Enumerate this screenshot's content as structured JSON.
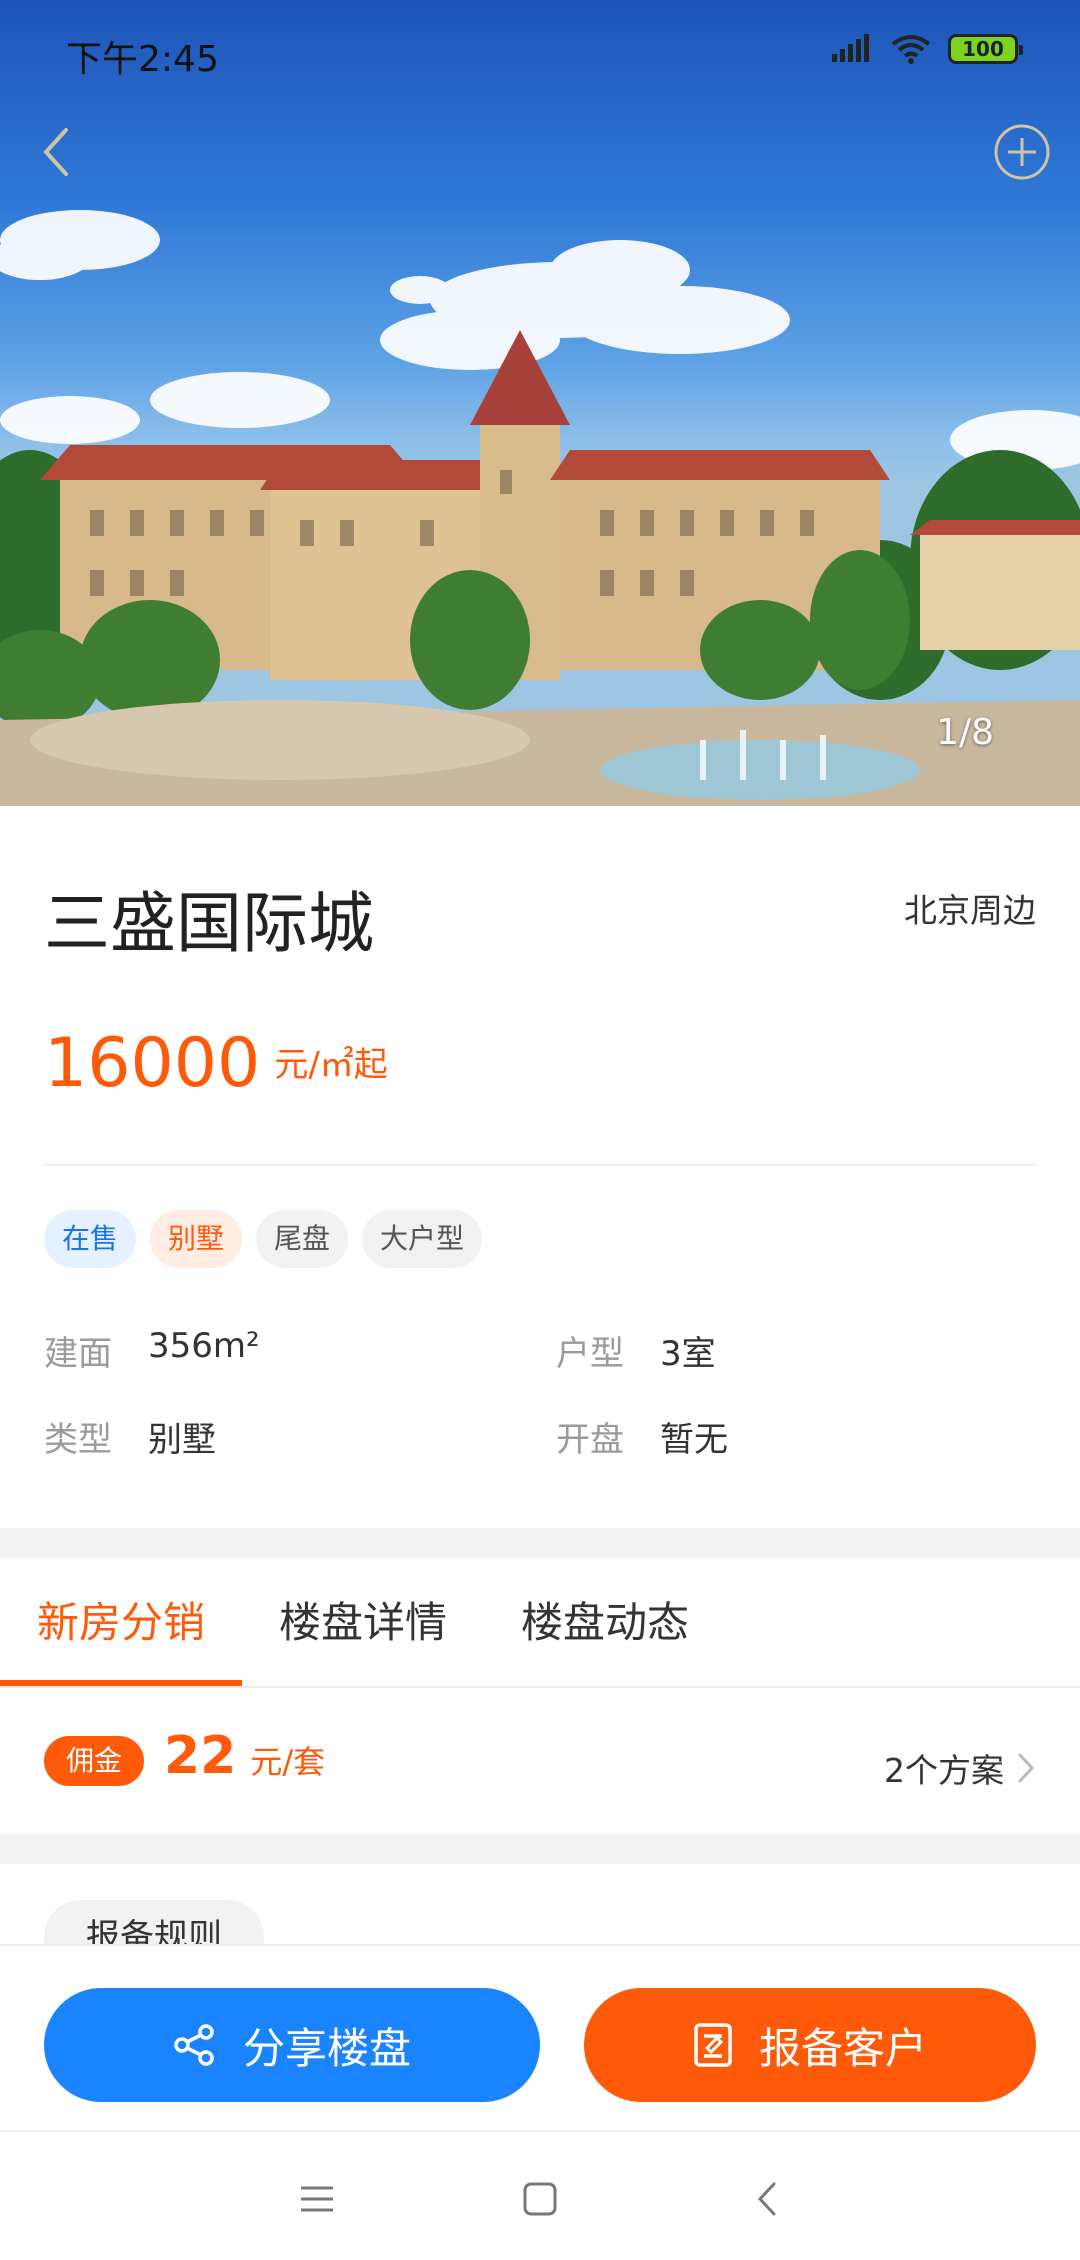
{
  "status_bar": {
    "time": "下午2:45",
    "battery": "100"
  },
  "gallery": {
    "counter": "1/8"
  },
  "property": {
    "name": "三盛国际城",
    "region": "北京周边",
    "price": "16000",
    "price_unit": "元/㎡起",
    "tags": [
      {
        "label": "在售",
        "style": "blue"
      },
      {
        "label": "别墅",
        "style": "orange"
      },
      {
        "label": "尾盘",
        "style": "gray"
      },
      {
        "label": "大户型",
        "style": "gray"
      }
    ],
    "attributes": [
      {
        "key": "建面",
        "value": "356m²"
      },
      {
        "key": "户型",
        "value": "3室"
      },
      {
        "key": "类型",
        "value": "别墅"
      },
      {
        "key": "开盘",
        "value": "暂无"
      }
    ]
  },
  "tabs": [
    {
      "label": "新房分销",
      "active": true
    },
    {
      "label": "楼盘详情",
      "active": false
    },
    {
      "label": "楼盘动态",
      "active": false
    }
  ],
  "commission": {
    "badge": "佣金",
    "amount": "22",
    "unit": "元/套",
    "plans": "2个方案"
  },
  "rules": {
    "label": "报备规则"
  },
  "actions": {
    "share_label": "分享楼盘",
    "report_label": "报备客户"
  },
  "colors": {
    "accent": "#ff5a0a",
    "primary_blue": "#1a84ff"
  },
  "icons": [
    "back-icon",
    "add-circle-icon",
    "share-icon",
    "report-icon",
    "chevron-right-icon",
    "menu-icon",
    "home-icon",
    "nav-back-icon"
  ]
}
